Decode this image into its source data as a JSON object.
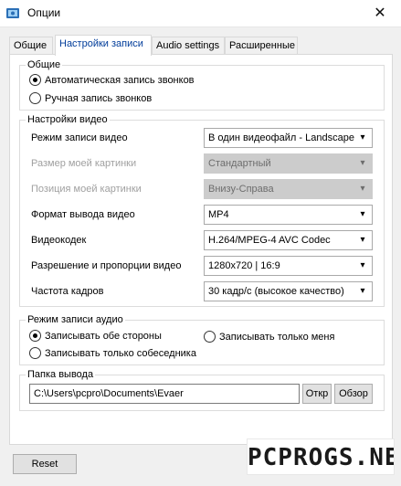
{
  "window": {
    "title": "Опции",
    "close_glyph": "✕",
    "icon": "app-icon"
  },
  "tabs": [
    {
      "label": "Общие",
      "active": false
    },
    {
      "label": "Настройки записи",
      "active": true
    },
    {
      "label": "Audio settings",
      "active": false
    },
    {
      "label": "Расширенные",
      "active": false
    }
  ],
  "general": {
    "title": "Общие",
    "auto_record": {
      "label": "Автоматическая запись звонков",
      "selected": true
    },
    "manual_record": {
      "label": "Ручная запись звонков",
      "selected": false
    }
  },
  "video": {
    "title": "Настройки видео",
    "rows": [
      {
        "label": "Режим записи видео",
        "value": "В один видеофайл - Landscape",
        "disabled": false
      },
      {
        "label": "Размер моей картинки",
        "value": "Стандартный",
        "disabled": true
      },
      {
        "label": "Позиция моей картинки",
        "value": "Внизу-Справа",
        "disabled": true
      },
      {
        "label": "Формат вывода видео",
        "value": "MP4",
        "disabled": false
      },
      {
        "label": "Видеокодек",
        "value": "H.264/MPEG-4 AVC Codec",
        "disabled": false
      },
      {
        "label": "Разрешение и пропорции видео",
        "value": "1280x720 | 16:9",
        "disabled": false
      },
      {
        "label": "Частота кадров",
        "value": "30 кадр/с (высокое качество)",
        "disabled": false
      }
    ]
  },
  "audio": {
    "title": "Режим записи аудио",
    "both_sides": {
      "label": "Записывать обе стороны",
      "selected": true
    },
    "only_me": {
      "label": "Записывать только меня",
      "selected": false
    },
    "only_peer": {
      "label": "Записывать только собеседника",
      "selected": false
    }
  },
  "output": {
    "title": "Папка вывода",
    "path": "C:\\Users\\pcpro\\Documents\\Evaer",
    "open_label": "Откр",
    "browse_label": "Обзор"
  },
  "footer": {
    "reset_label": "Reset",
    "watermark": "PCPROGS.NET"
  },
  "colors": {
    "active_tab_text": "#003c9a",
    "default_button_border": "#0078d7"
  }
}
